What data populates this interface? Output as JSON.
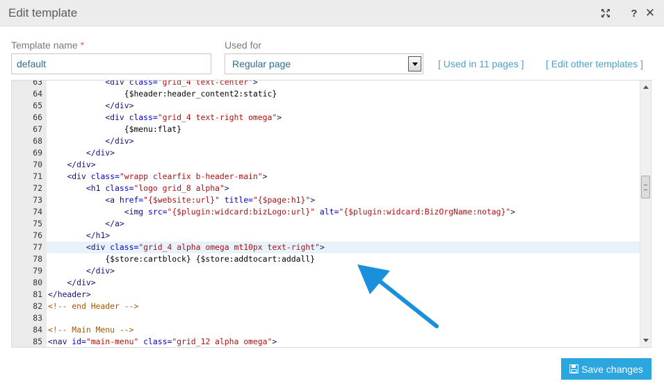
{
  "dialog": {
    "title": "Edit template",
    "help_icon": "?",
    "close_icon": "✕"
  },
  "form": {
    "template_name_label": "Template name",
    "required_mark": "*",
    "template_name_value": "default",
    "used_for_label": "Used for",
    "used_for_value": "Regular page",
    "used_in_link": "[ Used in 11 pages ]",
    "edit_other_link": "[ Edit other templates ]"
  },
  "editor": {
    "active_line": 77,
    "lines": [
      {
        "n": "63",
        "code": [
          [
            "            ",
            ""
          ],
          [
            "<div ",
            "t"
          ],
          [
            "class=",
            "a"
          ],
          [
            "\"grid_4 text-center\"",
            "s"
          ],
          [
            ">",
            "t"
          ]
        ]
      },
      {
        "n": "64",
        "code": [
          [
            "                {$header:header_content2:static}",
            ""
          ]
        ]
      },
      {
        "n": "65",
        "code": [
          [
            "            ",
            ""
          ],
          [
            "</div>",
            "t"
          ]
        ]
      },
      {
        "n": "66",
        "code": [
          [
            "            ",
            ""
          ],
          [
            "<div ",
            "t"
          ],
          [
            "class=",
            "a"
          ],
          [
            "\"grid_4 text-right omega\"",
            "s"
          ],
          [
            ">",
            "t"
          ]
        ]
      },
      {
        "n": "67",
        "code": [
          [
            "                {$menu:flat}",
            ""
          ]
        ]
      },
      {
        "n": "68",
        "code": [
          [
            "            ",
            ""
          ],
          [
            "</div>",
            "t"
          ]
        ]
      },
      {
        "n": "69",
        "code": [
          [
            "        ",
            ""
          ],
          [
            "</div>",
            "t"
          ]
        ]
      },
      {
        "n": "70",
        "code": [
          [
            "    ",
            ""
          ],
          [
            "</div>",
            "t"
          ]
        ]
      },
      {
        "n": "71",
        "code": [
          [
            "    ",
            ""
          ],
          [
            "<div ",
            "t"
          ],
          [
            "class=",
            "a"
          ],
          [
            "\"wrapp clearfix b-header-main\"",
            "s"
          ],
          [
            ">",
            "t"
          ]
        ]
      },
      {
        "n": "72",
        "code": [
          [
            "        ",
            ""
          ],
          [
            "<h1 ",
            "t"
          ],
          [
            "class=",
            "a"
          ],
          [
            "\"logo grid_8 alpha\"",
            "s"
          ],
          [
            ">",
            "t"
          ]
        ]
      },
      {
        "n": "73",
        "code": [
          [
            "            ",
            ""
          ],
          [
            "<a ",
            "t"
          ],
          [
            "href=",
            "a"
          ],
          [
            "\"{$website:url}\"",
            "s"
          ],
          [
            " title=",
            "a"
          ],
          [
            "\"{$page:h1}\"",
            "s"
          ],
          [
            ">",
            "t"
          ]
        ]
      },
      {
        "n": "74",
        "code": [
          [
            "                ",
            ""
          ],
          [
            "<img ",
            "t"
          ],
          [
            "src=",
            "a"
          ],
          [
            "\"{$plugin:widcard:bizLogo:url}\"",
            "s"
          ],
          [
            " alt=",
            "a"
          ],
          [
            "\"{$plugin:widcard:BizOrgName:notag}\"",
            "s"
          ],
          [
            ">",
            "t"
          ]
        ]
      },
      {
        "n": "75",
        "code": [
          [
            "            ",
            ""
          ],
          [
            "</a>",
            "t"
          ]
        ]
      },
      {
        "n": "76",
        "code": [
          [
            "        ",
            ""
          ],
          [
            "</h1>",
            "t"
          ]
        ]
      },
      {
        "n": "77",
        "code": [
          [
            "        ",
            ""
          ],
          [
            "<div ",
            "t"
          ],
          [
            "class=",
            "a"
          ],
          [
            "\"grid_4 alpha omega mt10px text-right\"",
            "s"
          ],
          [
            ">",
            "t"
          ]
        ]
      },
      {
        "n": "78",
        "code": [
          [
            "            {$store:cartblock} {$store:addtocart:addall}",
            ""
          ]
        ]
      },
      {
        "n": "79",
        "code": [
          [
            "        ",
            ""
          ],
          [
            "</div>",
            "t"
          ]
        ]
      },
      {
        "n": "80",
        "code": [
          [
            "    ",
            ""
          ],
          [
            "</div>",
            "t"
          ]
        ]
      },
      {
        "n": "81",
        "code": [
          [
            "",
            ""
          ],
          [
            "</header>",
            "t"
          ]
        ]
      },
      {
        "n": "82",
        "code": [
          [
            "",
            ""
          ],
          [
            "<!-- end Header -->",
            "c"
          ]
        ]
      },
      {
        "n": "83",
        "code": [
          [
            "",
            ""
          ]
        ]
      },
      {
        "n": "84",
        "code": [
          [
            "",
            ""
          ],
          [
            "<!-- Main Menu -->",
            "c"
          ]
        ]
      },
      {
        "n": "85",
        "code": [
          [
            "",
            ""
          ],
          [
            "<nav ",
            "t"
          ],
          [
            "id=",
            "a"
          ],
          [
            "\"main-menu\"",
            "s"
          ],
          [
            " class=",
            "a"
          ],
          [
            "\"grid_12 alpha omega\"",
            "s"
          ],
          [
            ">",
            "t"
          ]
        ]
      }
    ]
  },
  "footer": {
    "save_label": "Save changes"
  },
  "colors": {
    "accent": "#2ba6de",
    "link": "#4a9fd0",
    "annotation_arrow": "#1a8fdb"
  }
}
